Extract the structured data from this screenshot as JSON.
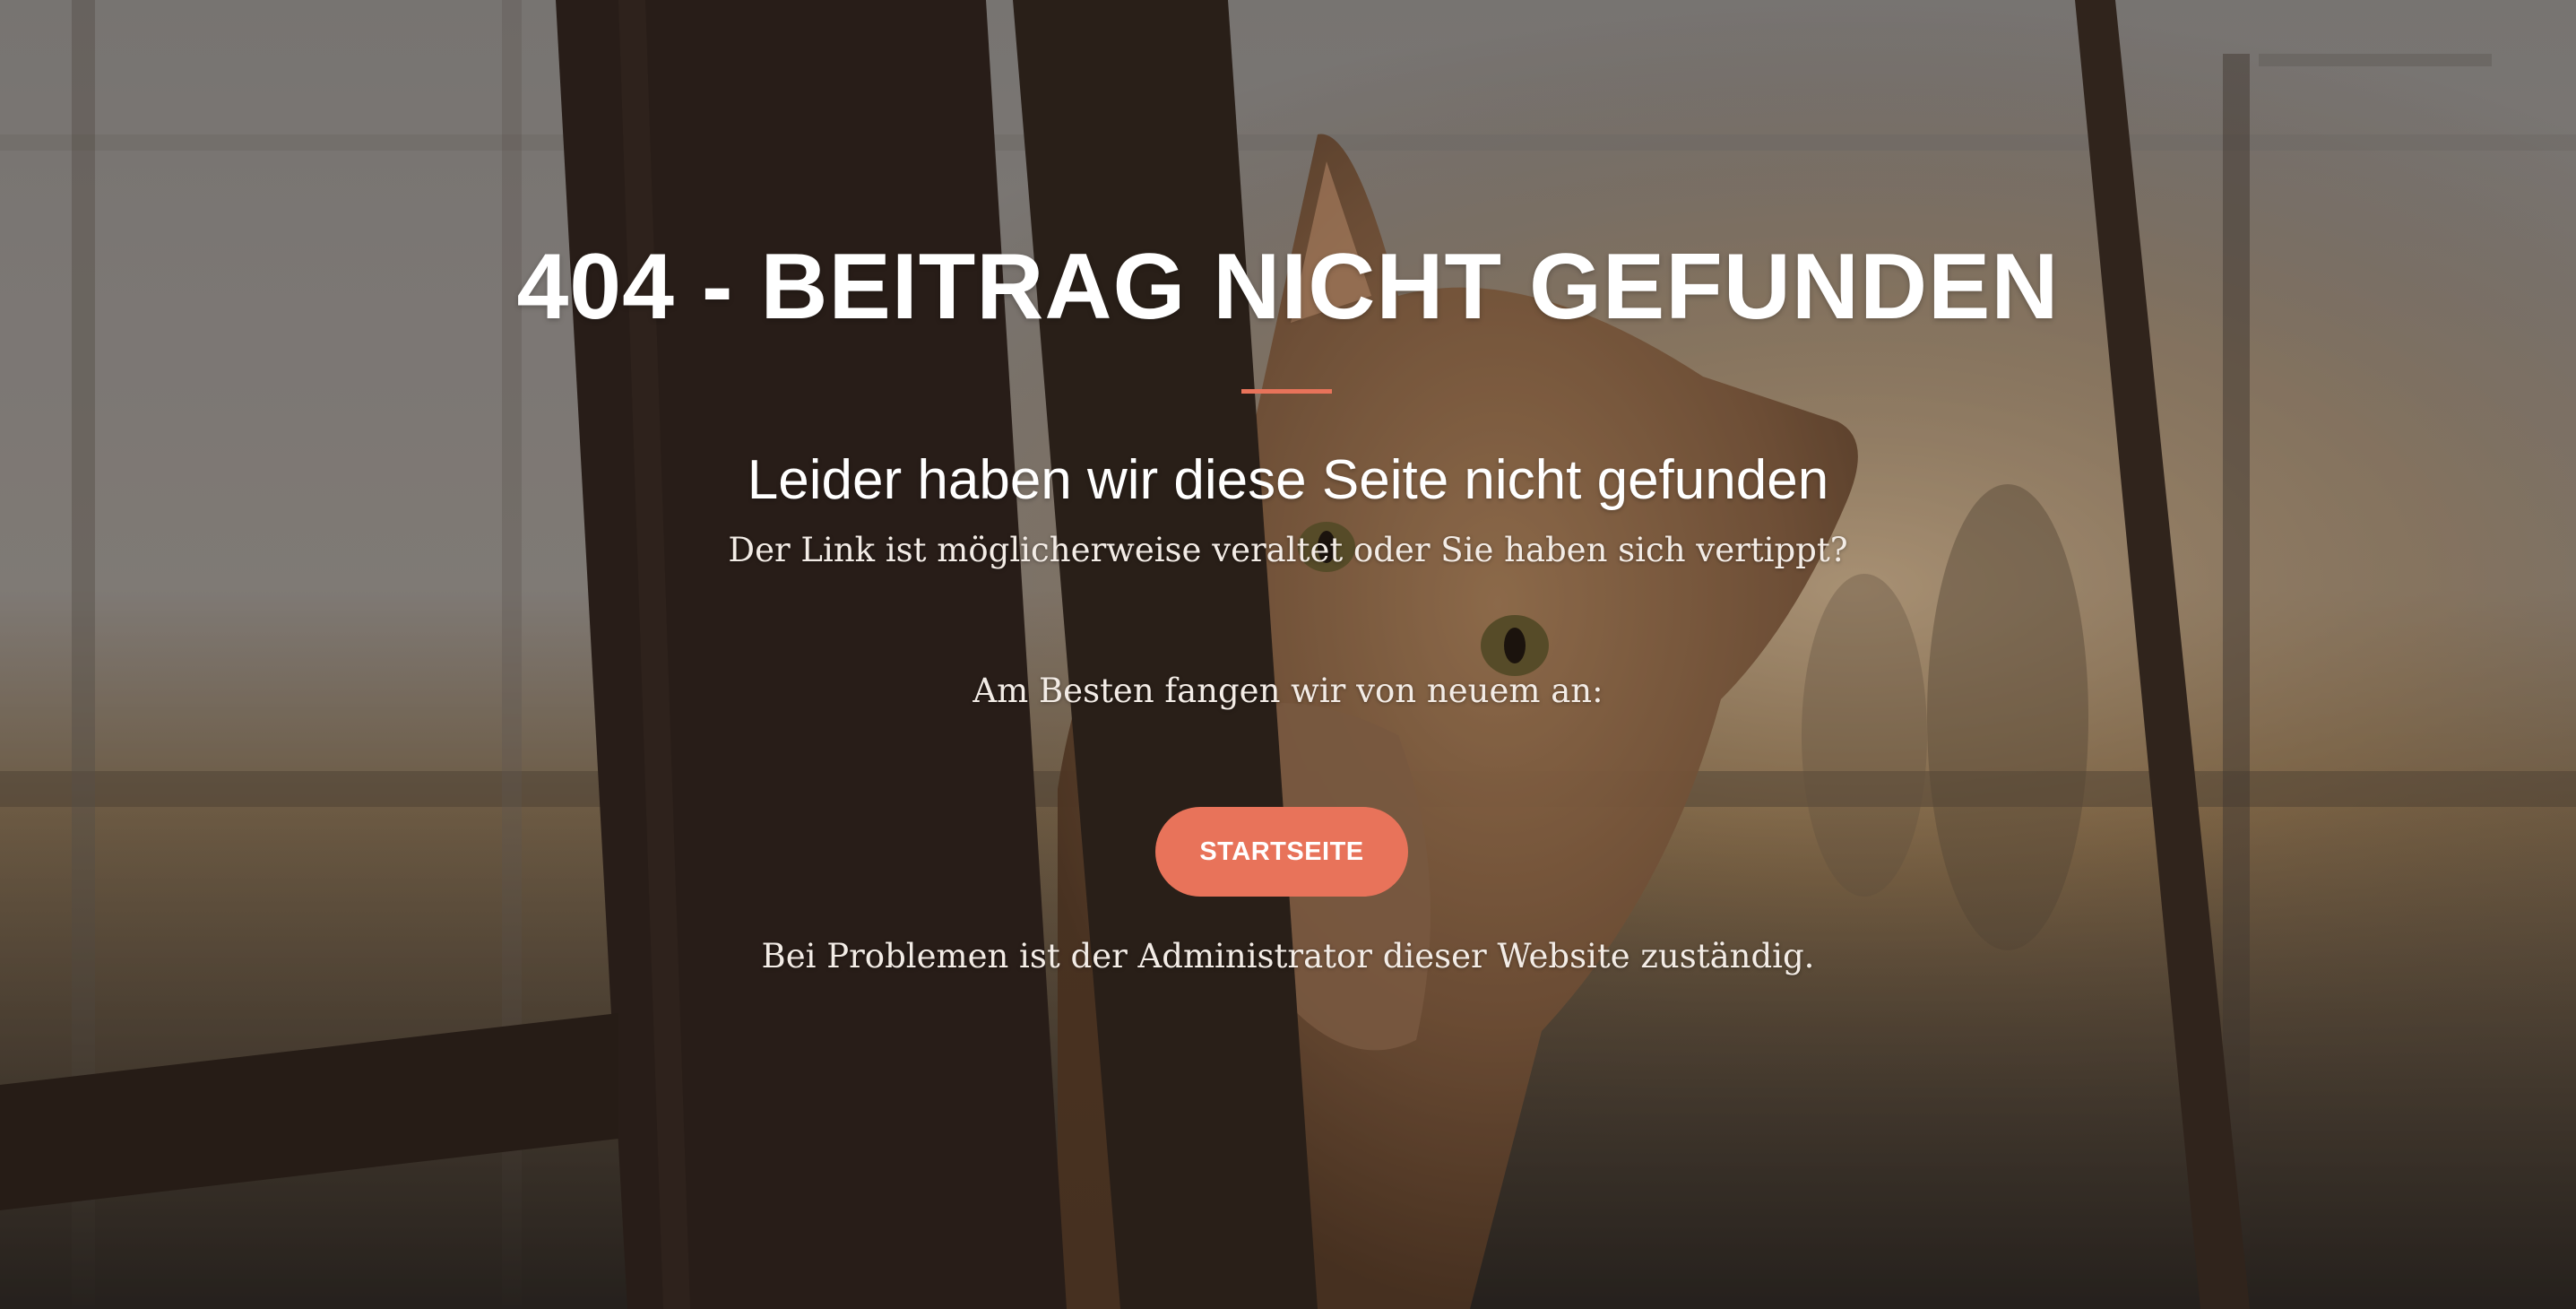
{
  "background": {
    "image": "cat-peeking-behind-rusty-bars-photo",
    "overlay_color": "#2a211b"
  },
  "error": {
    "title": "404 - BEITRAG NICHT GEFUNDEN",
    "subtitle": "Leider haben wir diese Seite nicht gefunden",
    "message": "Der Link ist möglicherweise veraltet oder Sie haben sich vertippt?",
    "prompt": "Am Besten fangen wir von neuem an:",
    "home_button_label": "STARTSEITE",
    "footer_note": "Bei Problemen ist der Administrator dieser Website zuständig."
  },
  "colors": {
    "accent": "#e8735a",
    "text": "#ffffff"
  }
}
